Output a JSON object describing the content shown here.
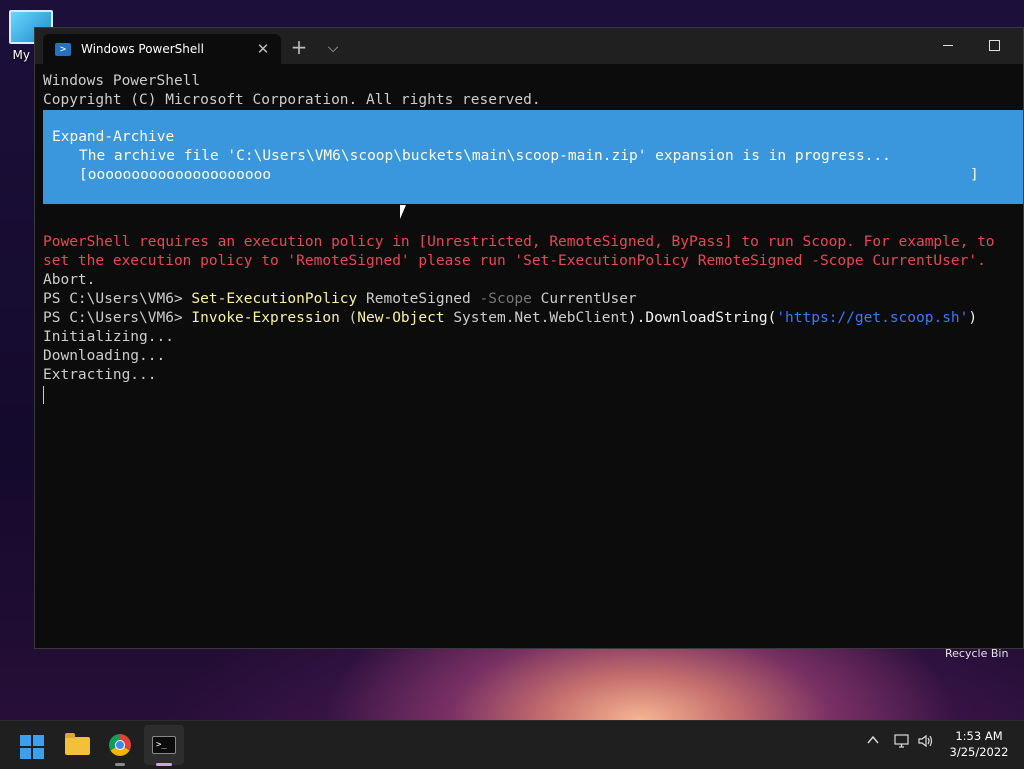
{
  "desktop": {
    "my_computer_label": "My Co",
    "recycle_bin_label": "Recycle Bin"
  },
  "window": {
    "tab_title": "Windows PowerShell",
    "tab_icon": "powershell-icon",
    "tab_close_glyph": "✕",
    "new_tab_glyph": "+",
    "dropdown_glyph": "⌵"
  },
  "console": {
    "header_1": "Windows PowerShell",
    "header_2": "Copyright (C) Microsoft Corporation. All rights reserved.",
    "progress": {
      "activity": "Expand-Archive",
      "status": "The archive file 'C:\\Users\\VM6\\scoop\\buckets\\main\\scoop-main.zip' expansion is in progress...",
      "bar": "[ooooooooooooooooooooo",
      "bar_end": "]",
      "background": "#3a96dd"
    },
    "error_1": "PowerShell requires an execution policy in [Unrestricted, RemoteSigned, ByPass] to run Scoop. For example, to",
    "error_2": "set the execution policy to 'RemoteSigned' please run 'Set-ExecutionPolicy RemoteSigned -Scope CurrentUser'.",
    "abort": "Abort.",
    "cmd1": {
      "prompt": "PS C:\\Users\\VM6> ",
      "command": "Set-ExecutionPolicy",
      "arg1": " RemoteSigned ",
      "param": "-Scope",
      "arg2": " CurrentUser"
    },
    "cmd2": {
      "prompt": "PS C:\\Users\\VM6> ",
      "command": "Invoke-Expression",
      "p1": " (",
      "command2": "New-Object",
      "arg": " System.Net.WebClient",
      "p2": ").DownloadString(",
      "url": "'https://get.scoop.sh'",
      "p3": ")"
    },
    "out_1": "Initializing...",
    "out_2": "Downloading...",
    "out_3": "Extracting..."
  },
  "taskbar": {
    "time": "1:53 AM",
    "date": "3/25/2022",
    "tray_chevron": "^",
    "icons": [
      "start-icon",
      "file-explorer-icon",
      "chrome-icon",
      "terminal-icon"
    ]
  },
  "colors": {
    "error": "#e74856",
    "command": "#f9f1a5",
    "parameter": "#767676",
    "string": "#3b78ff"
  }
}
